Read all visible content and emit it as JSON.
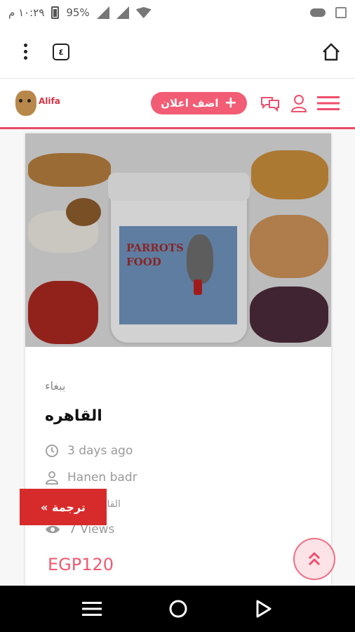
{
  "status_bar": {
    "time": "١٠:٢٩ م",
    "battery": "95%"
  },
  "browser": {
    "tab_count": "٤"
  },
  "header": {
    "logo_text": "Alifa",
    "add_ad_label": "اضف اعلان",
    "add_ad_icon": "plus-icon"
  },
  "card": {
    "category": "ببغاء",
    "title": "القاهره",
    "posted": "3 days ago",
    "author": "Hanen badr",
    "location": "القاهره",
    "views": "7 Views",
    "price": "EGP120",
    "image": {
      "product_text_line1": "PARROTS",
      "product_text_line2": "FOOD"
    }
  },
  "translate_button": {
    "label": "« ترجمة"
  },
  "scroll_top": {
    "label": "»"
  },
  "colors": {
    "accent": "#f35c75",
    "price": "#f05a72",
    "translate": "#d72b2b"
  }
}
